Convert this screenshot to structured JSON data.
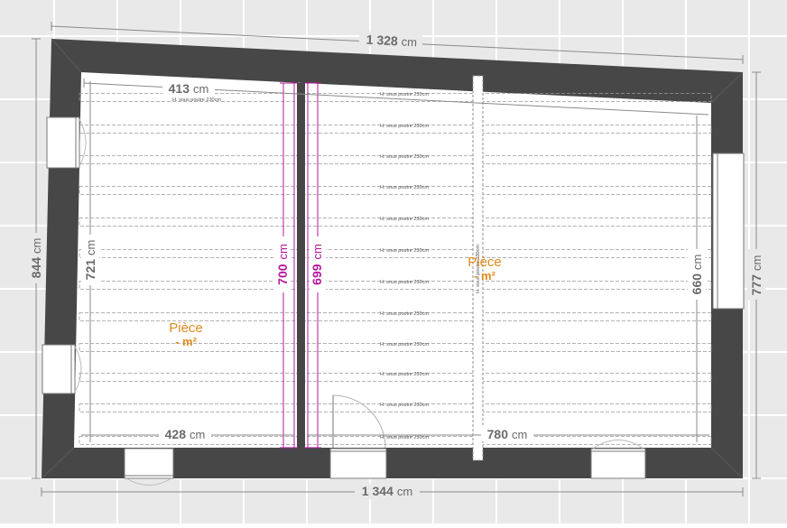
{
  "colors": {
    "background": "#e9e9e9",
    "tile_line": "#ffffff",
    "wall": "#474747",
    "floor": "#ffffff",
    "beam_line": "#9a9a9a",
    "dimension_text": "#6a6a6a",
    "magenta": "#b5179e",
    "room_label": "#e08a1e"
  },
  "dimensions": {
    "top": {
      "value": "1 328",
      "unit": "cm"
    },
    "bottom": {
      "value": "1 344",
      "unit": "cm"
    },
    "left": {
      "value": "844",
      "unit": "cm"
    },
    "right": {
      "value": "777",
      "unit": "cm"
    },
    "inner_top_left": {
      "value": "413",
      "unit": "cm"
    },
    "inner_left": {
      "value": "721",
      "unit": "cm"
    },
    "inner_right": {
      "value": "660",
      "unit": "cm"
    },
    "bottom_left_room": {
      "value": "428",
      "unit": "cm"
    },
    "bottom_right_room": {
      "value": "780",
      "unit": "cm"
    },
    "divider_left": {
      "value": "700",
      "unit": "cm"
    },
    "divider_right": {
      "value": "699",
      "unit": "cm"
    }
  },
  "beam_label": "H. sous poutre 230cm",
  "vertical_beam_label": "H. sous poutre 230cm",
  "rooms": [
    {
      "name": "Pièce",
      "area": "- m²"
    },
    {
      "name": "Pièce",
      "area": "- m²"
    }
  ]
}
